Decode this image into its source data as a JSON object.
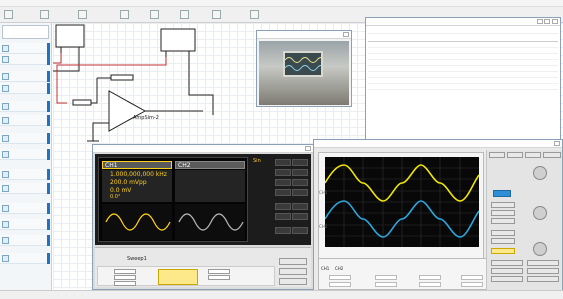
{
  "circuit": {
    "signal_source_label": "",
    "oscilloscope_label": "",
    "resistor_top_label": "",
    "resistor_in_label": "",
    "opamp_label": "AmpSim-2"
  },
  "generator": {
    "ch1_label": "CH1",
    "ch2_label": "CH2",
    "ch1_frequency": "1.000,000,000 kHz",
    "ch1_amplitude": "200.0 mVpp",
    "ch1_offset": "0.0 mV",
    "ch1_phase": "0.0°",
    "ch2_frequency": "",
    "ch2_amplitude": "",
    "ch2_offset": "",
    "ch2_phase": "",
    "wave_menu": [
      "Sin",
      "",
      "",
      "",
      "",
      "",
      "",
      ""
    ],
    "param_tabs": [
      "",
      "Sweep1",
      "",
      ""
    ],
    "status_text": ""
  },
  "scope": {
    "ch1_marker": "CH1",
    "ch2_marker": "CH2",
    "bottom_tabs": [
      "CH1",
      "CH2",
      "",
      "",
      "",
      "",
      ""
    ],
    "right_tabs": [
      "",
      "",
      "",
      ""
    ],
    "side_labels": [
      "",
      "",
      ""
    ],
    "channel_title": "",
    "button_rows": [
      "",
      "",
      "",
      ""
    ],
    "meas_title": ""
  },
  "colors": {
    "ch1_wave": "#f2e600",
    "ch2_wave": "#29a8e0",
    "gen_ch1": "#ffd11a",
    "gen_ch2": "#b8b8b8",
    "accent": "#1f73c4"
  }
}
